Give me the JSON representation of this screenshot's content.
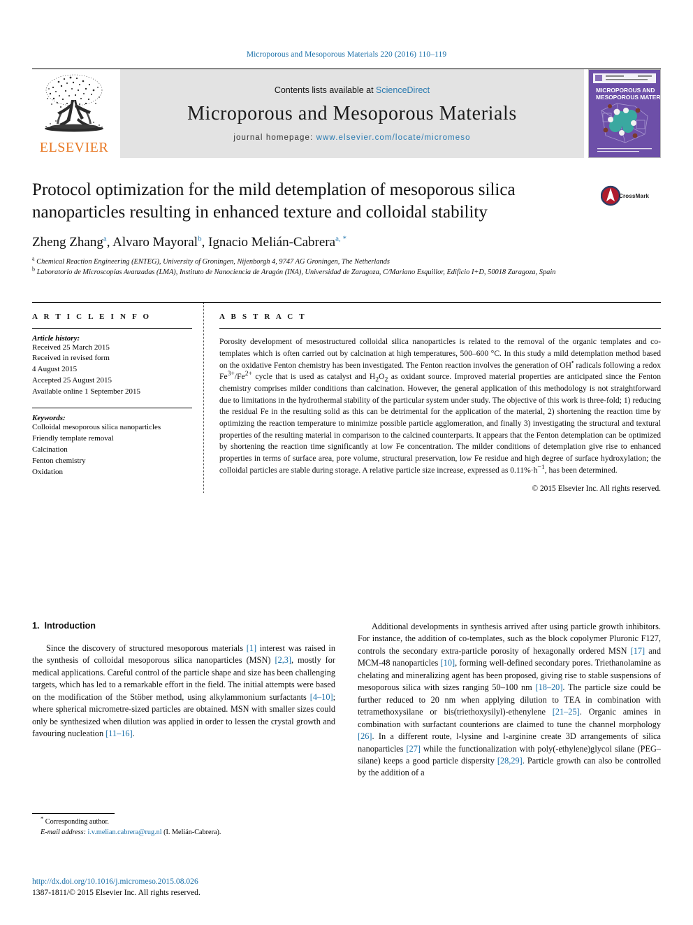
{
  "running_head": "Microporous and Mesoporous Materials 220 (2016) 110–119",
  "masthead": {
    "publisher_name": "ELSEVIER",
    "contents_prefix": "Contents lists available at ",
    "contents_link": "ScienceDirect",
    "journal_title": "Microporous and Mesoporous Materials",
    "homepage_prefix": "journal homepage: ",
    "homepage_url": "www.elsevier.com/locate/micromeso",
    "cover_title_line1": "MICROPOROUS AND",
    "cover_title_line2": "MESOPOROUS MATERIALS",
    "cover_color": "#6d4fa8"
  },
  "article": {
    "title": "Protocol optimization for the mild detemplation of mesoporous silica nanoparticles resulting in enhanced texture and colloidal stability",
    "authors": [
      {
        "name": "Zheng Zhang",
        "marks": "a"
      },
      {
        "name": "Alvaro Mayoral",
        "marks": "b"
      },
      {
        "name": "Ignacio Melián-Cabrera",
        "marks": "a, *"
      }
    ],
    "affiliations": [
      {
        "mark": "a",
        "text": "Chemical Reaction Engineering (ENTEG), University of Groningen, Nijenborgh 4, 9747 AG Groningen, The Netherlands"
      },
      {
        "mark": "b",
        "text": "Laboratorio de Microscopías Avanzadas (LMA), Instituto de Nanociencia de Aragón (INA), Universidad de Zaragoza, C/Mariano Esquillor, Edificio I+D, 50018 Zaragoza, Spain"
      }
    ],
    "crossmark_label": "CrossMark"
  },
  "article_info": {
    "heading": "A R T I C L E   I N F O",
    "history_label": "Article history:",
    "history": [
      "Received 25 March 2015",
      "Received in revised form",
      "4 August 2015",
      "Accepted 25 August 2015",
      "Available online 1 September 2015"
    ],
    "keywords_label": "Keywords:",
    "keywords": [
      "Colloidal mesoporous silica nanoparticles",
      "Friendly template removal",
      "Calcination",
      "Fenton chemistry",
      "Oxidation"
    ]
  },
  "abstract": {
    "heading": "A B S T R A C T",
    "paragraph_parts": [
      "Porosity development of mesostructured colloidal silica nanoparticles is related to the removal of the organic templates and co-templates which is often carried out by calcination at high temperatures, 500–600 °C. In this study a mild detemplation method based on the oxidative Fenton chemistry has been investigated. The Fenton reaction involves the generation of OH",
      " radicals following a redox Fe",
      "/Fe",
      " cycle that is used as catalyst and H",
      "O",
      " as oxidant source. Improved material properties are anticipated since the Fenton chemistry comprises milder conditions than calcination. However, the general application of this methodology is not straightforward due to limitations in the hydrothermal stability of the particular system under study. The objective of this work is three-fold; 1) reducing the residual Fe in the resulting solid as this can be detrimental for the application of the material, 2) shortening the reaction time by optimizing the reaction temperature to minimize possible particle agglomeration, and finally 3) investigating the structural and textural properties of the resulting material in comparison to the calcined counterparts. It appears that the Fenton detemplation can be optimized by shortening the reaction time significantly at low Fe concentration. The milder conditions of detemplation give rise to enhanced properties in terms of surface area, pore volume, structural preservation, low Fe residue and high degree of surface hydroxylation; the colloidal particles are stable during storage. A relative particle size increase, expressed as 0.11%·h",
      ", has been determined."
    ],
    "sup_radical": "•",
    "sup_fe3": "3+",
    "sup_fe2": "2+",
    "sub_h2": "2",
    "sub_o2": "2",
    "sup_h_minus1": "−1",
    "copyright": "© 2015 Elsevier Inc. All rights reserved."
  },
  "introduction": {
    "number": "1.",
    "heading": "Introduction",
    "left_parts": [
      "Since the discovery of structured mesoporous materials ",
      "[1]",
      " interest was raised in the synthesis of colloidal mesoporous silica nanoparticles (MSN) ",
      "[2,3]",
      ", mostly for medical applications. Careful control of the particle shape and size has been challenging targets, which has led to a remarkable effort in the field. The initial attempts were based on the modification of the Stöber method, using alkylammonium surfactants ",
      "[4–10]",
      "; where spherical micrometre-sized particles are obtained. MSN with smaller sizes could only be synthesized when dilution was applied in order to lessen the crystal growth and favouring nucleation ",
      "[11–16]",
      "."
    ],
    "right_parts": [
      "Additional developments in synthesis arrived after using particle growth inhibitors. For instance, the addition of co-templates, such as the block copolymer Pluronic F127, controls the secondary extra-particle porosity of hexagonally ordered MSN ",
      "[17]",
      " and MCM-48 nanoparticles ",
      "[10]",
      ", forming well-defined secondary pores. Triethanolamine as chelating and mineralizing agent has been proposed, giving rise to stable suspensions of mesoporous silica with sizes ranging 50–100 nm ",
      "[18–20]",
      ". The particle size could be further reduced to 20 nm when applying dilution to TEA in combination with tetramethoxysilane or bis(triethoxysilyl)-ethenylene ",
      "[21–25]",
      ". Organic amines in combination with surfactant counterions are claimed to tune the channel morphology ",
      "[26]",
      ". In a different route, l-lysine and l-arginine create 3D arrangements of silica nanoparticles ",
      "[27]",
      " while the functionalization with poly(-ethylene)glycol silane (PEG–silane) keeps a good particle dispersity ",
      "[28,29]",
      ". Particle growth can also be controlled by the addition of a"
    ]
  },
  "footer": {
    "corresponding_marker": "*",
    "corresponding_label": "Corresponding author.",
    "email_label": "E-mail address:",
    "email": "i.v.melian.cabrera@rug.nl",
    "email_owner": "(I. Melián-Cabrera).",
    "doi": "http://dx.doi.org/10.1016/j.micromeso.2015.08.026",
    "issn_line": "1387-1811/© 2015 Elsevier Inc. All rights reserved."
  },
  "colors": {
    "link_blue": "#1a6fa8",
    "elsevier_orange": "#E87722",
    "masthead_grey": "#e3e3e3"
  }
}
